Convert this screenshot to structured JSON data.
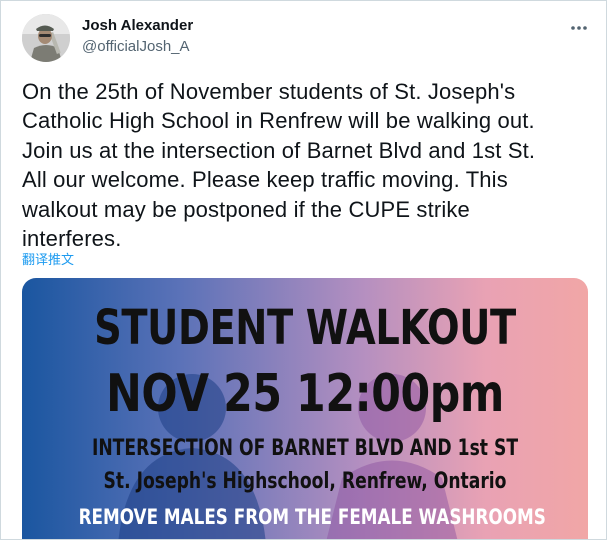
{
  "author": {
    "name": "Josh Alexander",
    "handle": "@officialJosh_A",
    "avatar_icon": "person-photo-avatar"
  },
  "more_icon": "more-horizontal-icon",
  "tweet": {
    "lines": [
      "On the 25th of November students of St. Joseph's",
      "Catholic High School in Renfrew will be walking out.",
      "Join us at the intersection of Barnet Blvd and 1st St.",
      "All our welcome. Please keep traffic moving. This",
      "walkout may be postponed if the CUPE strike",
      "interferes."
    ],
    "translate_label": "翻译推文"
  },
  "media": {
    "title": "STUDENT WALKOUT",
    "date_time": "NOV 25 12:00pm",
    "location_line1": "INTERSECTION OF BARNET BLVD AND 1st ST",
    "location_line2": "St. Joseph's Highschool, Renfrew, Ontario",
    "message": "REMOVE MALES FROM THE FEMALE WASHROOMS"
  },
  "colors": {
    "link": "#1d9bf0",
    "handle": "#536471",
    "gradient_left": "#1a56a0",
    "gradient_right": "#f1a6a6"
  }
}
